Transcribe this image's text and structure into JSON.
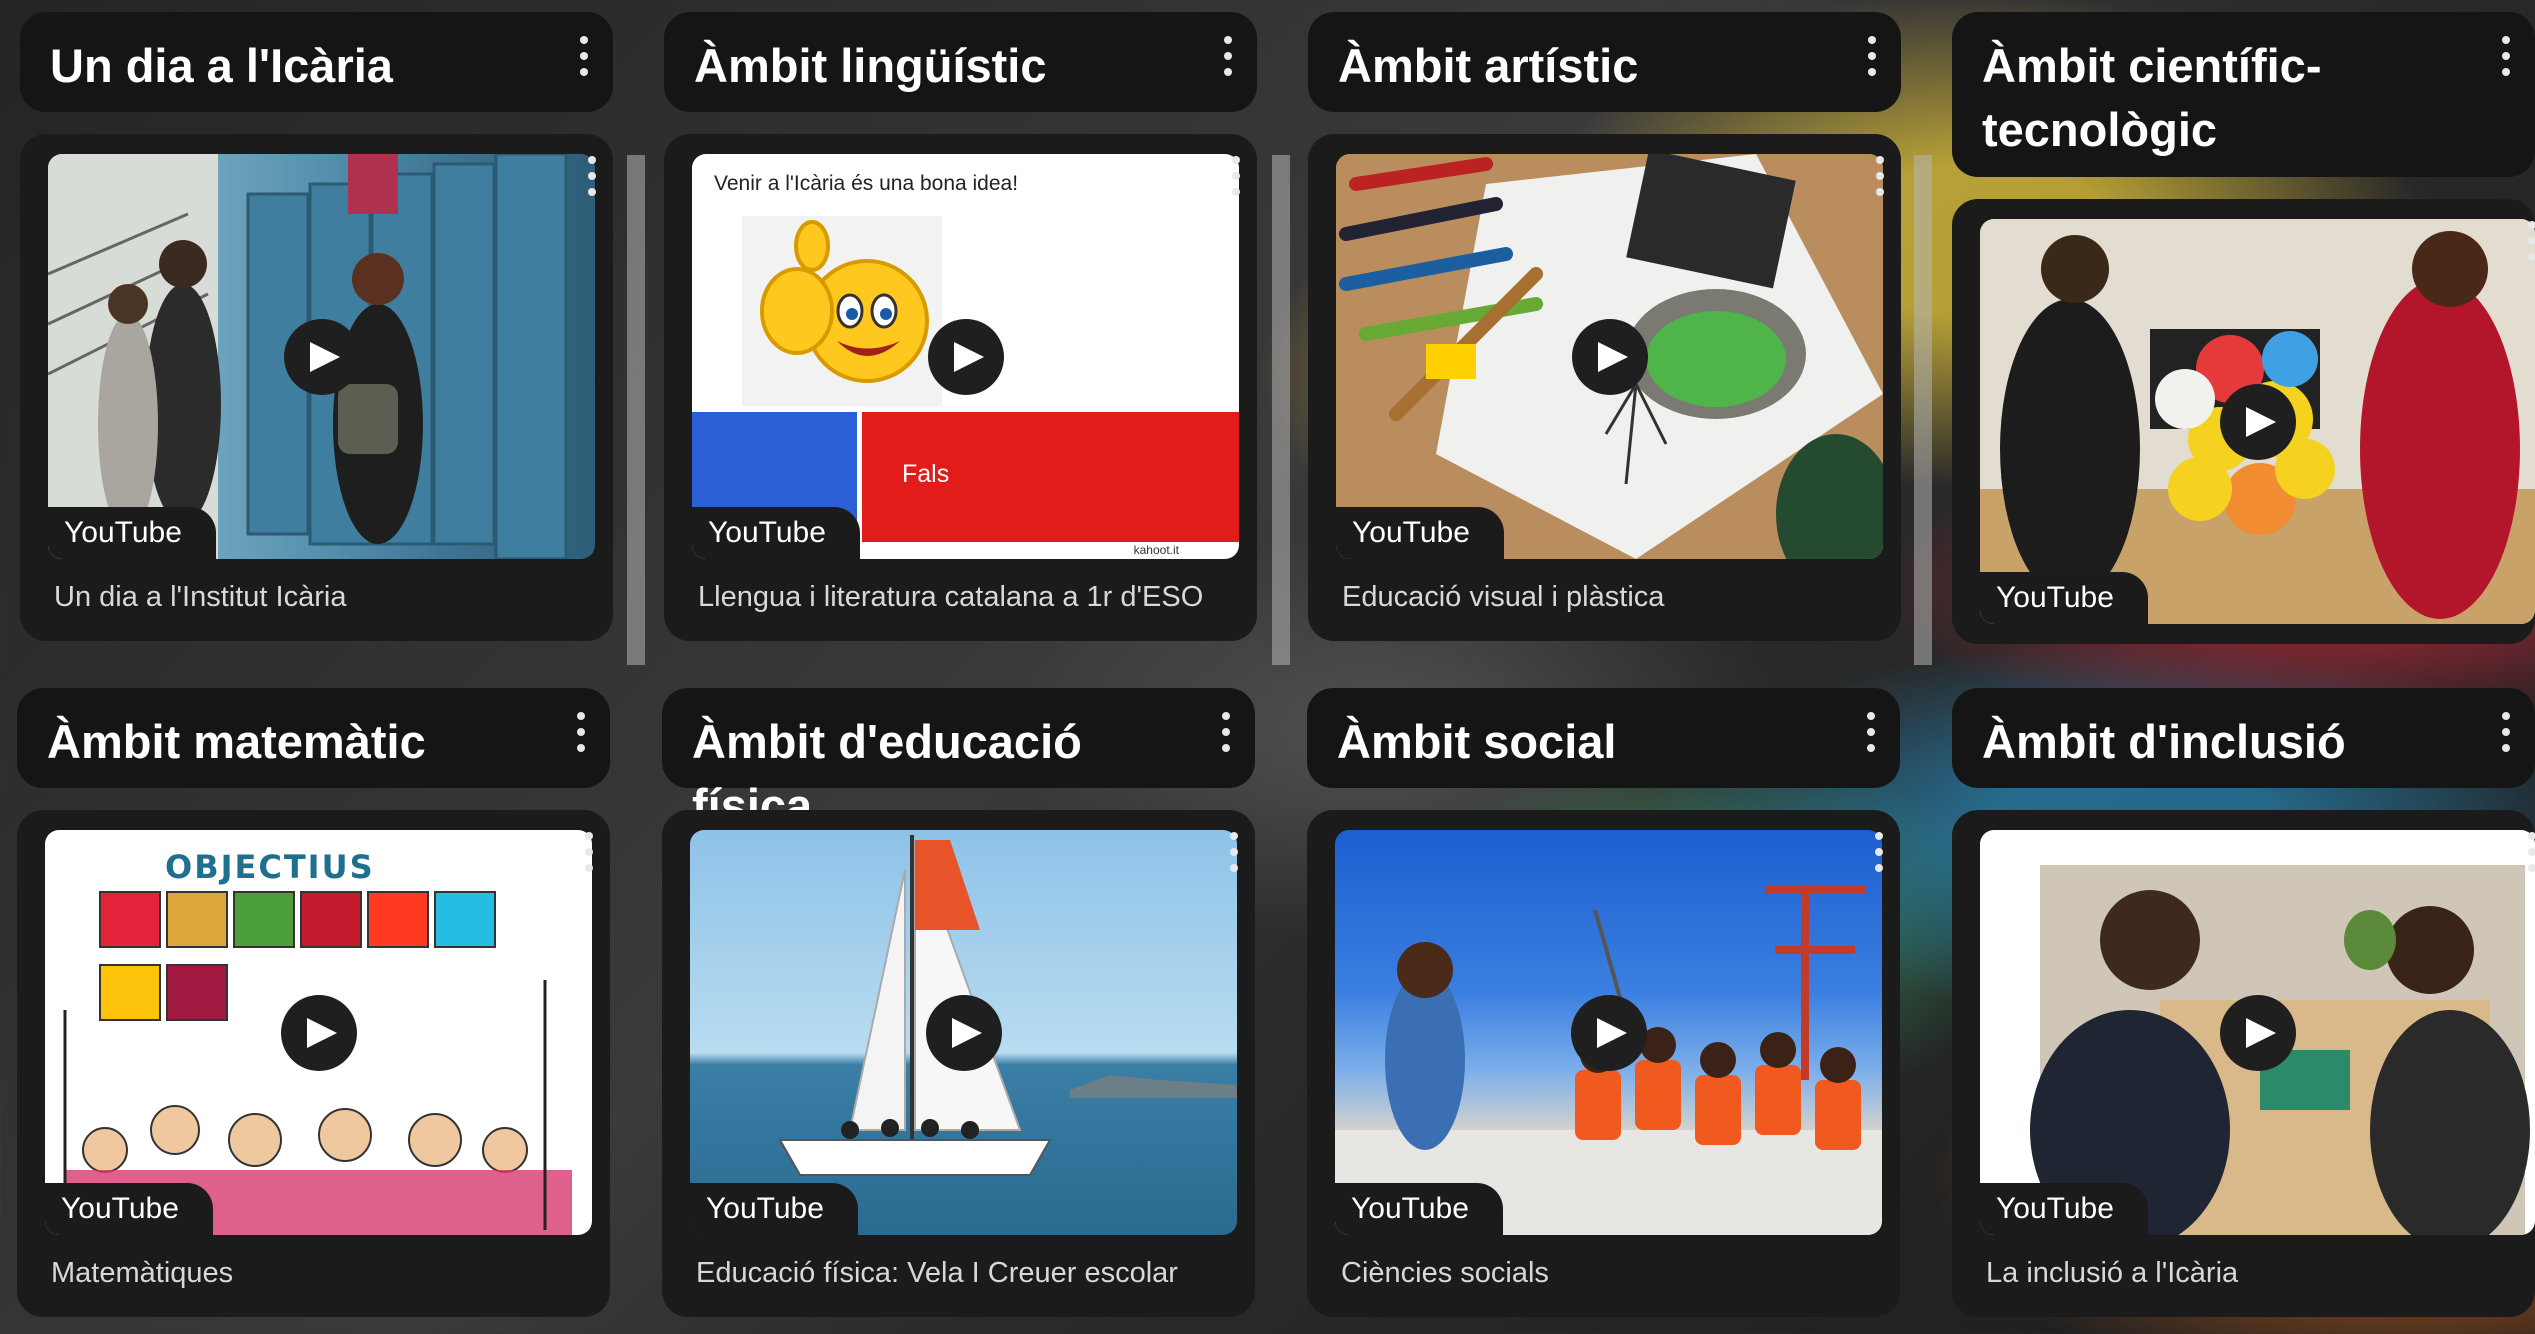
{
  "board": {
    "sections": [
      {
        "title": "Un dia a l'Icària",
        "card": {
          "source": "YouTube",
          "caption": "Un dia a l'Institut Icària"
        }
      },
      {
        "title": "Àmbit lingüístic",
        "card": {
          "source": "YouTube",
          "caption": "Llengua i literatura catalana a 1r d'ESO",
          "slide": {
            "header": "Venir a l'Icària és una bona idea!",
            "answer": "Fals",
            "footer": "kahoot.it"
          }
        }
      },
      {
        "title": "Àmbit artístic",
        "card": {
          "source": "YouTube",
          "caption": "Educació visual i plàstica"
        }
      },
      {
        "title": "Àmbit científic-tecnològic",
        "card": {
          "source": "YouTube",
          "caption": ""
        }
      },
      {
        "title": "Àmbit matemàtic",
        "card": {
          "source": "YouTube",
          "caption": "Matemàtiques",
          "slide": {
            "header": "OBJECTIUS"
          }
        }
      },
      {
        "title": "Àmbit d'educació física",
        "card": {
          "source": "YouTube",
          "caption": "Educació física: Vela I Creuer escolar"
        }
      },
      {
        "title": "Àmbit social",
        "card": {
          "source": "YouTube",
          "caption": "Ciències socials"
        }
      },
      {
        "title": "Àmbit d'inclusió",
        "card": {
          "source": "YouTube",
          "caption": "La inclusió a l'Icària"
        }
      }
    ]
  },
  "icons": {
    "play": "play-icon",
    "menu": "kebab-menu-icon"
  },
  "colors": {
    "card_bg": "#1b1b1b",
    "section_bg": "#151515",
    "text": "#ffffff",
    "caption": "#d8d8d8"
  }
}
